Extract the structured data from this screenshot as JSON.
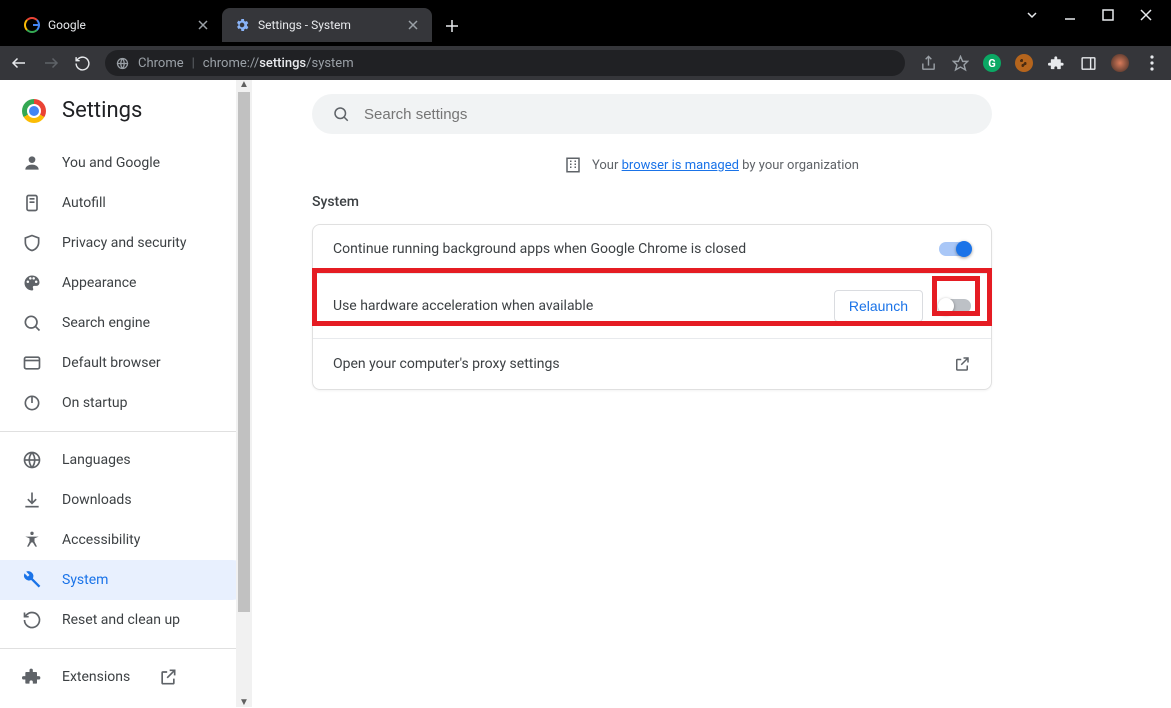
{
  "tabs": [
    {
      "title": "Google"
    },
    {
      "title": "Settings - System"
    }
  ],
  "omnibox": {
    "prefix": "Chrome",
    "pre_url": "chrome://",
    "bold": "settings",
    "post_url": "/system"
  },
  "brand": "Settings",
  "search_placeholder": "Search settings",
  "managed_pre": "Your ",
  "managed_link": "browser is managed",
  "managed_post": " by your organization",
  "section": "System",
  "rows": {
    "bg": "Continue running background apps when Google Chrome is closed",
    "hw": "Use hardware acceleration when available",
    "relaunch": "Relaunch",
    "proxy": "Open your computer's proxy settings"
  },
  "nav": {
    "g1": [
      "You and Google",
      "Autofill",
      "Privacy and security",
      "Appearance",
      "Search engine",
      "Default browser",
      "On startup"
    ],
    "g2": [
      "Languages",
      "Downloads",
      "Accessibility",
      "System",
      "Reset and clean up"
    ],
    "g3": [
      "Extensions"
    ]
  }
}
